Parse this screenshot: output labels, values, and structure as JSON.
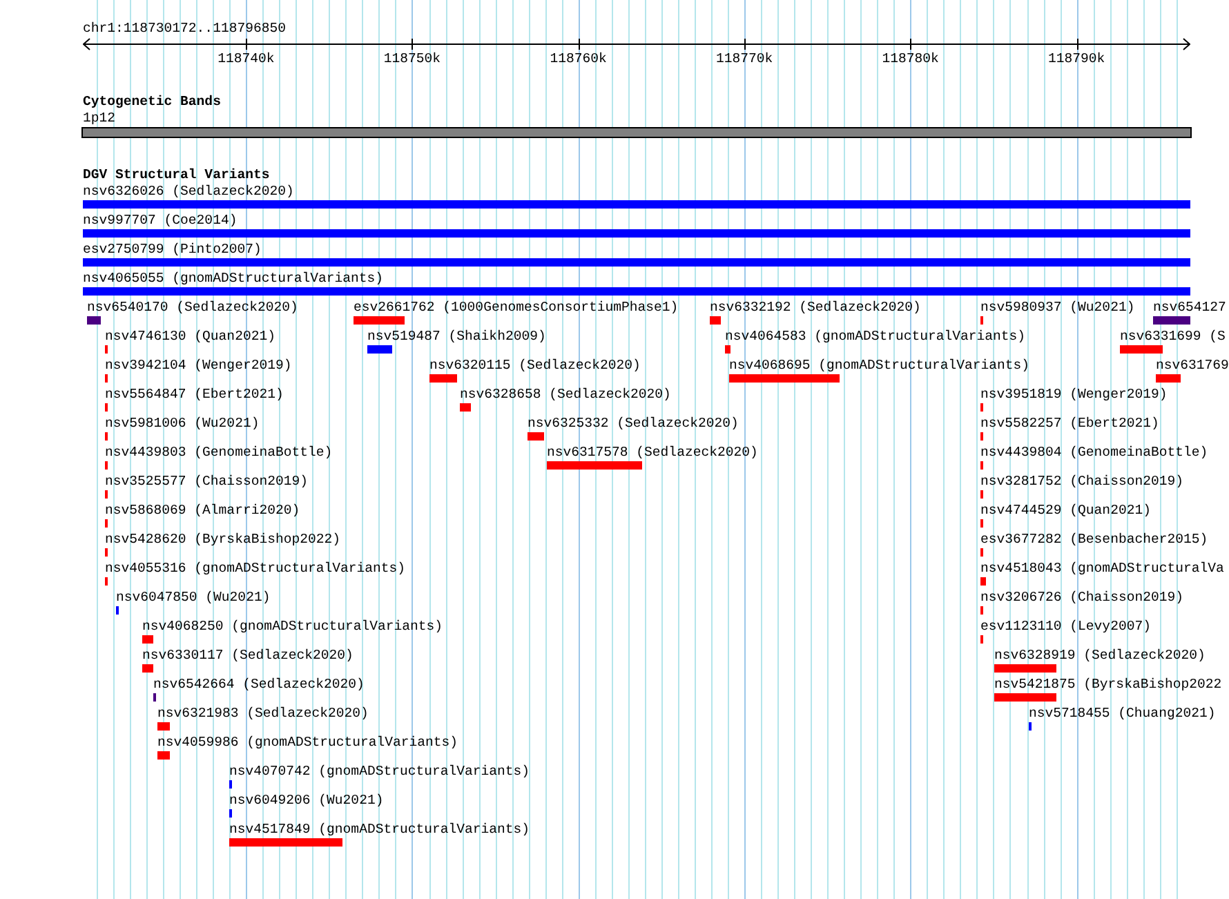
{
  "ruler": {
    "location": "chr1:118730172..118796850",
    "ticks": [
      "118740k",
      "118750k",
      "118760k",
      "118770k",
      "118780k",
      "118790k"
    ]
  },
  "tracks": [
    {
      "title": "Cytogenetic Bands",
      "kind": "bands",
      "rows": [
        [
          {
            "label": "1p12",
            "color": "#808080"
          }
        ]
      ]
    },
    {
      "title": "DGV Structural Variants",
      "kind": "variants",
      "rows": [
        [
          {
            "label": "nsv6326026 (Sedlazeck2020)",
            "color": "#0000ff"
          }
        ],
        [
          {
            "label": "nsv997707 (Coe2014)",
            "color": "#0000ff"
          }
        ],
        [
          {
            "label": "esv2750799 (Pinto2007)",
            "color": "#0000ff"
          }
        ],
        [
          {
            "label": "nsv4065055 (gnomADStructuralVariants)",
            "color": "#0000ff"
          }
        ],
        [
          {
            "label": "nsv6540170 (Sedlazeck2020)",
            "color": "#4b0082"
          },
          {
            "label": "esv2661762 (1000GenomesConsortiumPhase1)",
            "color": "#ff0000"
          },
          {
            "label": "nsv6332192 (Sedlazeck2020)",
            "color": "#ff0000"
          },
          {
            "label": "nsv5980937 (Wu2021)",
            "color": "#ff0000"
          },
          {
            "label": "nsv654127",
            "color": "#4b0082"
          }
        ],
        [
          {
            "label": "nsv4746130 (Quan2021)",
            "color": "#ff0000"
          },
          {
            "label": "nsv519487 (Shaikh2009)",
            "color": "#0000ff"
          },
          {
            "label": "nsv4064583 (gnomADStructuralVariants)",
            "color": "#ff0000"
          },
          {
            "label": "nsv6331699 (S",
            "color": "#ff0000"
          }
        ],
        [
          {
            "label": "nsv3942104 (Wenger2019)",
            "color": "#ff0000"
          },
          {
            "label": "nsv6320115 (Sedlazeck2020)",
            "color": "#ff0000"
          },
          {
            "label": "nsv4068695 (gnomADStructuralVariants)",
            "color": "#ff0000"
          },
          {
            "label": "nsv631769",
            "color": "#ff0000"
          }
        ],
        [
          {
            "label": "nsv5564847 (Ebert2021)",
            "color": "#ff0000"
          },
          {
            "label": "nsv6328658 (Sedlazeck2020)",
            "color": "#ff0000"
          },
          {
            "label": "nsv3951819 (Wenger2019)",
            "color": "#ff0000"
          }
        ],
        [
          {
            "label": "nsv5981006 (Wu2021)",
            "color": "#ff0000"
          },
          {
            "label": "nsv6325332 (Sedlazeck2020)",
            "color": "#ff0000"
          },
          {
            "label": "nsv5582257 (Ebert2021)",
            "color": "#ff0000"
          }
        ],
        [
          {
            "label": "nsv4439803 (GenomeinaBottle)",
            "color": "#ff0000"
          },
          {
            "label": "nsv6317578 (Sedlazeck2020)",
            "color": "#ff0000"
          },
          {
            "label": "nsv4439804 (GenomeinaBottle)",
            "color": "#ff0000"
          }
        ],
        [
          {
            "label": "nsv3525577 (Chaisson2019)",
            "color": "#ff0000"
          },
          {
            "label": "nsv3281752 (Chaisson2019)",
            "color": "#ff0000"
          }
        ],
        [
          {
            "label": "nsv5868069 (Almarri2020)",
            "color": "#ff0000"
          },
          {
            "label": "nsv4744529 (Quan2021)",
            "color": "#ff0000"
          }
        ],
        [
          {
            "label": "nsv5428620 (ByrskaBishop2022)",
            "color": "#ff0000"
          },
          {
            "label": "esv3677282 (Besenbacher2015)",
            "color": "#ff0000"
          }
        ],
        [
          {
            "label": "nsv4055316 (gnomADStructuralVariants)",
            "color": "#ff0000"
          },
          {
            "label": "nsv4518043 (gnomADStructuralVa",
            "color": "#ff0000"
          }
        ],
        [
          {
            "label": "nsv6047850 (Wu2021)",
            "color": "#0000ff"
          },
          {
            "label": "nsv3206726 (Chaisson2019)",
            "color": "#ff0000"
          }
        ],
        [
          {
            "label": "nsv4068250 (gnomADStructuralVariants)",
            "color": "#ff0000"
          },
          {
            "label": "esv1123110 (Levy2007)",
            "color": "#ff0000"
          }
        ],
        [
          {
            "label": "nsv6330117 (Sedlazeck2020)",
            "color": "#ff0000"
          },
          {
            "label": "nsv6328919 (Sedlazeck2020)",
            "color": "#ff0000"
          }
        ],
        [
          {
            "label": "nsv6542664 (Sedlazeck2020)",
            "color": "#4b0082"
          },
          {
            "label": "nsv5421875 (ByrskaBishop2022",
            "color": "#ff0000"
          }
        ],
        [
          {
            "label": "nsv6321983 (Sedlazeck2020)",
            "color": "#ff0000"
          },
          {
            "label": "nsv5718455 (Chuang2021)",
            "color": "#0000ff"
          }
        ],
        [
          {
            "label": "nsv4059986 (gnomADStructuralVariants)",
            "color": "#ff0000"
          }
        ],
        [
          {
            "label": "nsv4070742 (gnomADStructuralVariants)",
            "color": "#0000ff"
          }
        ],
        [
          {
            "label": "nsv6049206 (Wu2021)",
            "color": "#0000ff"
          }
        ],
        [
          {
            "label": "nsv4517849 (gnomADStructuralVariants)",
            "color": "#ff0000"
          }
        ]
      ]
    }
  ]
}
